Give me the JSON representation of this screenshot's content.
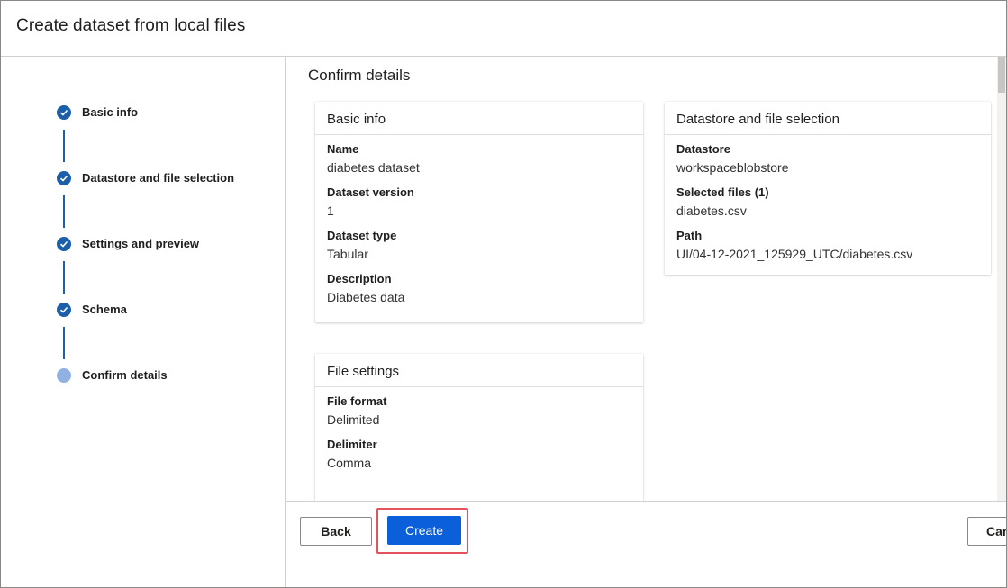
{
  "dialog": {
    "title": "Create dataset from local files"
  },
  "steps": [
    {
      "label": "Basic info",
      "status": "completed"
    },
    {
      "label": "Datastore and file selection",
      "status": "completed"
    },
    {
      "label": "Settings and preview",
      "status": "completed"
    },
    {
      "label": "Schema",
      "status": "completed"
    },
    {
      "label": "Confirm details",
      "status": "current"
    }
  ],
  "main": {
    "title": "Confirm details",
    "basic_info": {
      "title": "Basic info",
      "fields": [
        {
          "label": "Name",
          "value": "diabetes dataset"
        },
        {
          "label": "Dataset version",
          "value": "1"
        },
        {
          "label": "Dataset type",
          "value": "Tabular"
        },
        {
          "label": "Description",
          "value": "Diabetes data"
        }
      ]
    },
    "datastore": {
      "title": "Datastore and file selection",
      "fields": [
        {
          "label": "Datastore",
          "value": "workspaceblobstore"
        },
        {
          "label": "Selected files (1)",
          "value": "diabetes.csv"
        },
        {
          "label": "Path",
          "value": "UI/04-12-2021_125929_UTC/diabetes.csv"
        }
      ]
    },
    "file_settings": {
      "title": "File settings",
      "fields": [
        {
          "label": "File format",
          "value": "Delimited"
        },
        {
          "label": "Delimiter",
          "value": "Comma"
        }
      ]
    }
  },
  "footer": {
    "back_label": "Back",
    "create_label": "Create",
    "cancel_label": "Can"
  },
  "colors": {
    "step_completed": "#1b5fab",
    "step_current": "#8fb2e3",
    "primary_button": "#0b5fda",
    "highlight_border": "#e3525d"
  },
  "icons": {
    "step_completed": "checkmark-icon",
    "step_current": "circle-icon"
  }
}
